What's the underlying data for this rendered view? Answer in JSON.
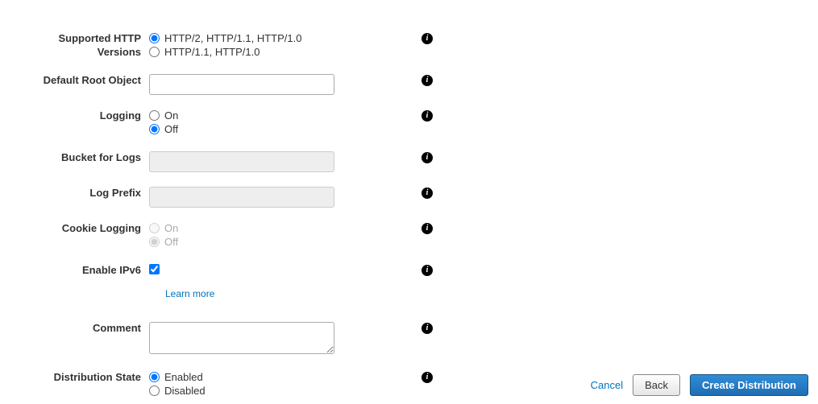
{
  "fields": {
    "http_versions": {
      "label": "Supported HTTP Versions",
      "options": {
        "http2": "HTTP/2, HTTP/1.1, HTTP/1.0",
        "http11": "HTTP/1.1, HTTP/1.0"
      },
      "selected": "http2"
    },
    "default_root": {
      "label": "Default Root Object",
      "value": ""
    },
    "logging": {
      "label": "Logging",
      "options": {
        "on": "On",
        "off": "Off"
      },
      "selected": "off"
    },
    "bucket_logs": {
      "label": "Bucket for Logs",
      "value": "",
      "disabled": true
    },
    "log_prefix": {
      "label": "Log Prefix",
      "value": "",
      "disabled": true
    },
    "cookie_logging": {
      "label": "Cookie Logging",
      "options": {
        "on": "On",
        "off": "Off"
      },
      "selected": "off",
      "disabled": true
    },
    "enable_ipv6": {
      "label": "Enable IPv6",
      "checked": true,
      "learn_more": "Learn more"
    },
    "comment": {
      "label": "Comment",
      "value": ""
    },
    "distribution_state": {
      "label": "Distribution State",
      "options": {
        "enabled": "Enabled",
        "disabled": "Disabled"
      },
      "selected": "enabled"
    }
  },
  "info_glyph": "i",
  "footer": {
    "cancel": "Cancel",
    "back": "Back",
    "create": "Create Distribution"
  }
}
